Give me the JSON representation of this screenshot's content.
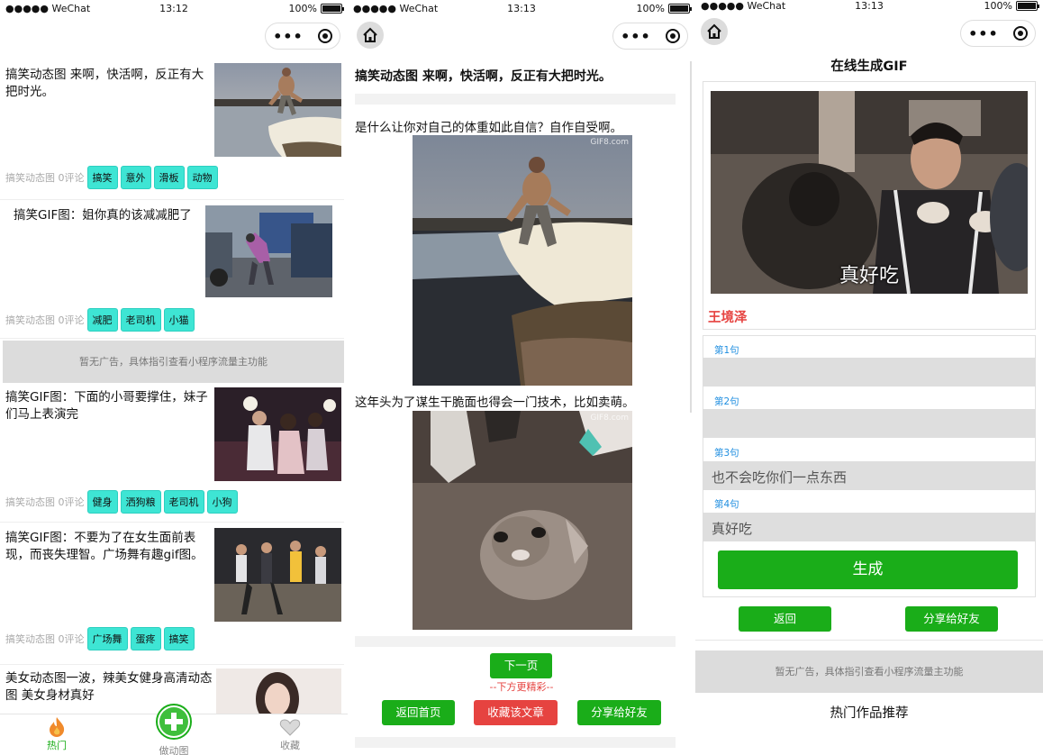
{
  "status": {
    "carrier": "●●●●● WeChat",
    "battery": "100%",
    "times": [
      "13:12",
      "13:13",
      "13:13"
    ]
  },
  "capsule": {
    "more": "•••"
  },
  "feed": {
    "items": [
      {
        "title": "搞笑动态图 来啊，快活啊，反正有大把时光。",
        "meta": "搞笑动态图 0评论",
        "tags": [
          "搞笑",
          "意外",
          "滑板",
          "动物"
        ]
      },
      {
        "title": "搞笑GIF图：姐你真的该减减肥了",
        "meta": "搞笑动态图 0评论",
        "tags": [
          "减肥",
          "老司机",
          "小猫"
        ]
      },
      {
        "title": "搞笑GIF图：下面的小哥要撑住，妹子们马上表演完",
        "meta": "搞笑动态图 0评论",
        "tags": [
          "健身",
          "洒狗粮",
          "老司机",
          "小狗"
        ]
      },
      {
        "title": "搞笑GIF图：不要为了在女生面前表现，而丧失理智。广场舞有趣gif图。",
        "meta": "搞笑动态图 0评论",
        "tags": [
          "广场舞",
          "蛋疼",
          "搞笑"
        ]
      },
      {
        "title": "美女动态图一波，辣美女健身高清动态图 美女身材真好",
        "meta": "",
        "tags": []
      }
    ],
    "ad_text": "暂无广告，具体指引查看小程序流量主功能"
  },
  "tabbar": {
    "hot": "热门",
    "make": "做动图",
    "fav": "收藏"
  },
  "article": {
    "title": "搞笑动态图 来啊，快活啊，反正有大把时光。",
    "para1": "是什么让你对自己的体重如此自信？自作自受啊。",
    "para2": "这年头为了谋生干脆面也得会一门技术，比如卖萌。",
    "watermark": "GIF8.com",
    "next_label": "下一页",
    "more_hint": "--下方更精彩--",
    "home_label": "返回首页",
    "collect_label": "收藏该文章",
    "share_label": "分享给好友"
  },
  "maker": {
    "title": "在线生成GIF",
    "caption": "真好吃",
    "name": "王境泽",
    "lines": [
      {
        "label": "第1句",
        "value": ""
      },
      {
        "label": "第2句",
        "value": ""
      },
      {
        "label": "第3句",
        "value": "也不会吃你们一点东西"
      },
      {
        "label": "第4句",
        "value": "真好吃"
      }
    ],
    "generate_label": "生成",
    "back_label": "返回",
    "share_label": "分享给好友",
    "ad_text": "暂无广告，具体指引查看小程序流量主功能",
    "hot_label": "热门作品推荐"
  }
}
